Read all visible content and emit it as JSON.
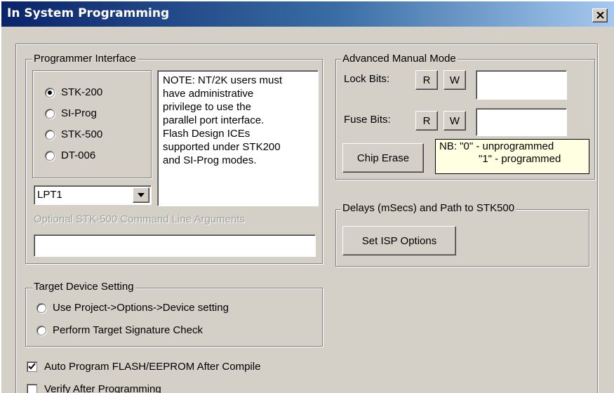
{
  "window": {
    "title": "In System Programming",
    "close_symbol": "×"
  },
  "programmer_interface": {
    "legend": "Programmer Interface",
    "options": [
      {
        "label": "STK-200",
        "selected": true
      },
      {
        "label": "SI-Prog",
        "selected": false
      },
      {
        "label": "STK-500",
        "selected": false
      },
      {
        "label": "DT-006",
        "selected": false
      }
    ],
    "note_lines": [
      "NOTE: NT/2K users must",
      "have administrative",
      "privilege to use the",
      "parallel port interface.",
      "Flash Design ICEs",
      "supported under STK200",
      "and SI-Prog modes."
    ],
    "port_value": "LPT1",
    "stk500_args_label": "Optional STK-500 Command Line Arguments",
    "stk500_args_value": ""
  },
  "advanced_manual_mode": {
    "legend": "Advanced Manual Mode",
    "lock_bits_label": "Lock Bits:",
    "fuse_bits_label": "Fuse Bits:",
    "read_label": "R",
    "write_label": "W",
    "lock_bits_value": "",
    "fuse_bits_value": "",
    "chip_erase_label": "Chip Erase",
    "nb_line1": "NB: \"0\" - unprogrammed",
    "nb_line2": "\"1\" - programmed"
  },
  "delays": {
    "legend": "Delays (mSecs)  and Path to STK500",
    "set_isp_options_label": "Set ISP Options"
  },
  "target_device": {
    "legend": "Target Device Setting",
    "options": [
      {
        "label": "Use Project->Options->Device setting",
        "selected": false
      },
      {
        "label": "Perform Target Signature Check",
        "selected": false
      }
    ]
  },
  "checkboxes": [
    {
      "label": "Auto Program FLASH/EEPROM After Compile",
      "checked": true
    },
    {
      "label": "Verify After Programming",
      "checked": false
    }
  ],
  "colors": {
    "dialog_face": "#d4d0c8",
    "title_gradient_start": "#0a246a",
    "title_gradient_end": "#a6caf0",
    "tooltip_bg": "#ffffe1"
  }
}
